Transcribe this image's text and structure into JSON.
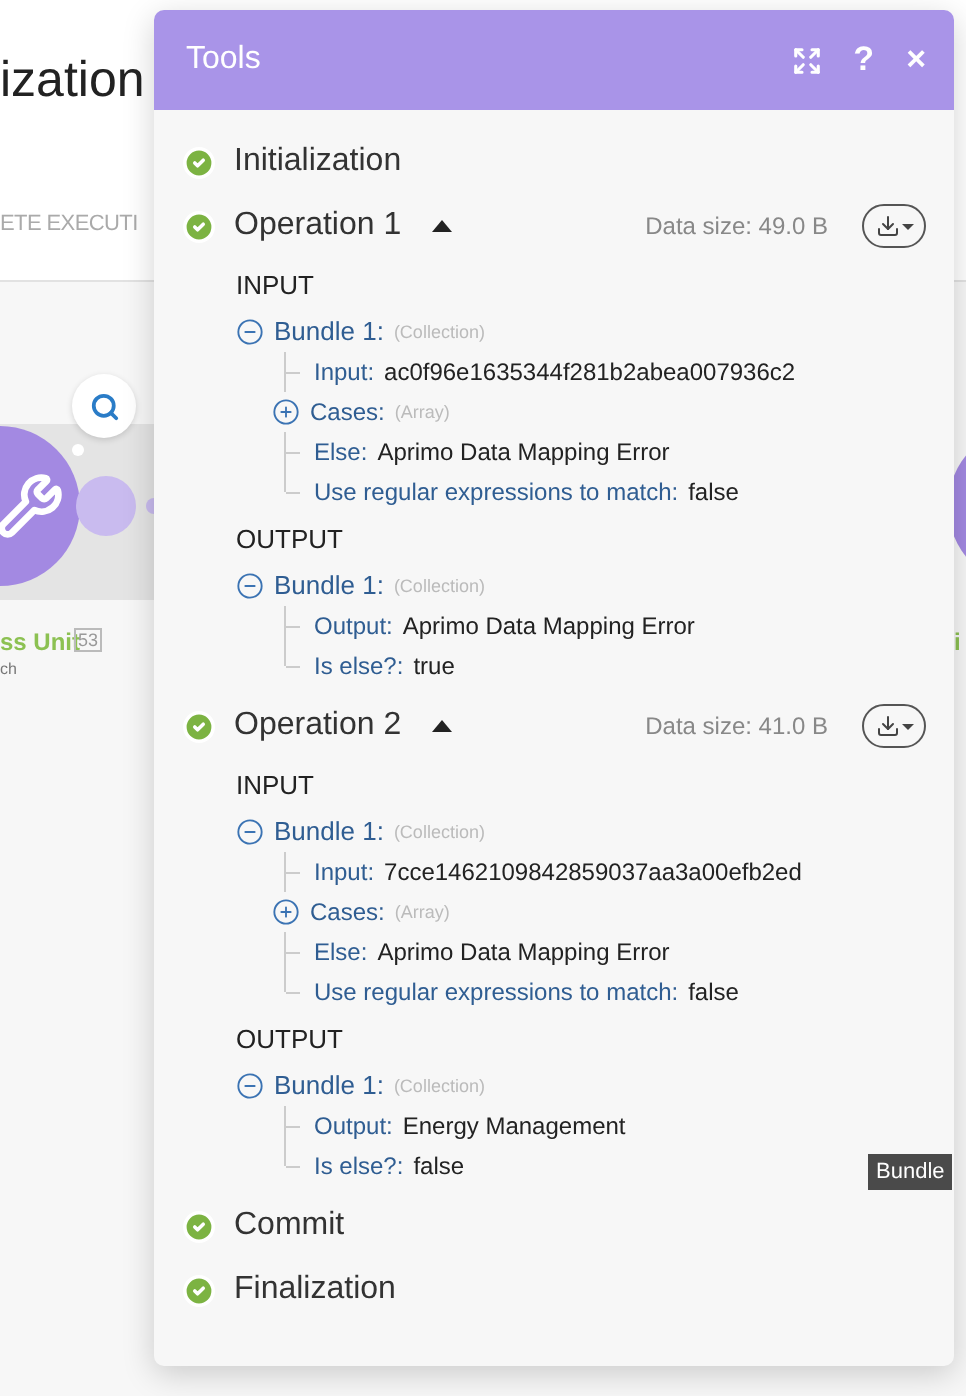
{
  "background": {
    "title": "ization",
    "subtitle": "ETE EXECUTI",
    "module": {
      "name": "ss Unit",
      "badge": "53",
      "sub": "ch"
    },
    "module_right": {
      "name": "i"
    },
    "tooltip": "Bundle"
  },
  "panel": {
    "title": "Tools",
    "help": "?",
    "close": "×",
    "steps": [
      {
        "kind": "step",
        "label": "Initialization"
      },
      {
        "kind": "operation",
        "label": "Operation 1",
        "expanded": true,
        "data_size": "Data size: 49.0 B",
        "sections": [
          {
            "heading": "INPUT",
            "bundles": [
              {
                "label": "Bundle 1:",
                "type": "(Collection)",
                "expanded": true,
                "fields": [
                  {
                    "key": "Input:",
                    "value": "ac0f96e1635344f281b2abea007936c2"
                  },
                  {
                    "key": "Cases:",
                    "type": "(Array)",
                    "expanded": false
                  },
                  {
                    "key": "Else:",
                    "value": "Aprimo Data Mapping Error"
                  },
                  {
                    "key": "Use regular expressions to match:",
                    "value": "false"
                  }
                ]
              }
            ]
          },
          {
            "heading": "OUTPUT",
            "bundles": [
              {
                "label": "Bundle 1:",
                "type": "(Collection)",
                "expanded": true,
                "fields": [
                  {
                    "key": "Output:",
                    "value": "Aprimo Data Mapping Error"
                  },
                  {
                    "key": "Is else?:",
                    "value": "true"
                  }
                ]
              }
            ]
          }
        ]
      },
      {
        "kind": "operation",
        "label": "Operation 2",
        "expanded": true,
        "data_size": "Data size: 41.0 B",
        "sections": [
          {
            "heading": "INPUT",
            "bundles": [
              {
                "label": "Bundle 1:",
                "type": "(Collection)",
                "expanded": true,
                "fields": [
                  {
                    "key": "Input:",
                    "value": "7cce1462109842859037aa3a00efb2ed"
                  },
                  {
                    "key": "Cases:",
                    "type": "(Array)",
                    "expanded": false
                  },
                  {
                    "key": "Else:",
                    "value": "Aprimo Data Mapping Error"
                  },
                  {
                    "key": "Use regular expressions to match:",
                    "value": "false"
                  }
                ]
              }
            ]
          },
          {
            "heading": "OUTPUT",
            "bundles": [
              {
                "label": "Bundle 1:",
                "type": "(Collection)",
                "expanded": true,
                "fields": [
                  {
                    "key": "Output:",
                    "value": "Energy Management"
                  },
                  {
                    "key": "Is else?:",
                    "value": "false"
                  }
                ]
              }
            ]
          }
        ]
      },
      {
        "kind": "step",
        "label": "Commit"
      },
      {
        "kind": "step",
        "label": "Finalization"
      }
    ]
  }
}
